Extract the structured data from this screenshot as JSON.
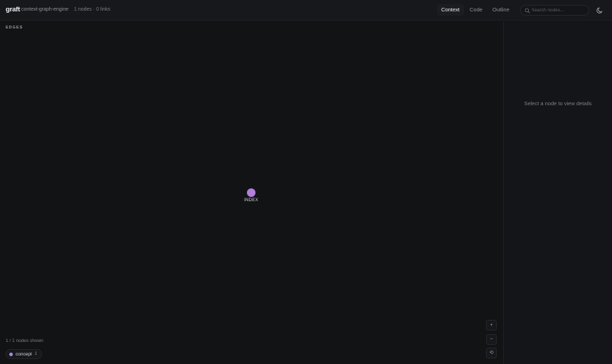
{
  "header": {
    "brand": "graft",
    "project": "context-graph-engine",
    "stats": "1 nodes · 0 links",
    "tabs": [
      {
        "label": "Context",
        "active": true
      },
      {
        "label": "Code",
        "active": false
      },
      {
        "label": "Outline",
        "active": false
      }
    ],
    "search": {
      "placeholder": "Search nodes...",
      "value": "",
      "icon": "search-icon"
    },
    "theme_toggle_icon": "moon-icon"
  },
  "canvas": {
    "edges_label": "EDGES",
    "nodes": [
      {
        "label": "INDEX",
        "type": "concept",
        "color": "#b47fdc"
      }
    ],
    "nodes_shown": "1 / 1 nodes shown",
    "legend": [
      {
        "name": "concept",
        "count": "1",
        "color": "#a58cd8"
      }
    ],
    "zoom_controls": {
      "zoom_in": "+",
      "zoom_out": "−",
      "reset": "⟲"
    }
  },
  "details_panel": {
    "empty_message": "Select a node to view details"
  },
  "colors": {
    "background": "#121315",
    "topbar": "#17181b",
    "node": "#b47fdc"
  }
}
